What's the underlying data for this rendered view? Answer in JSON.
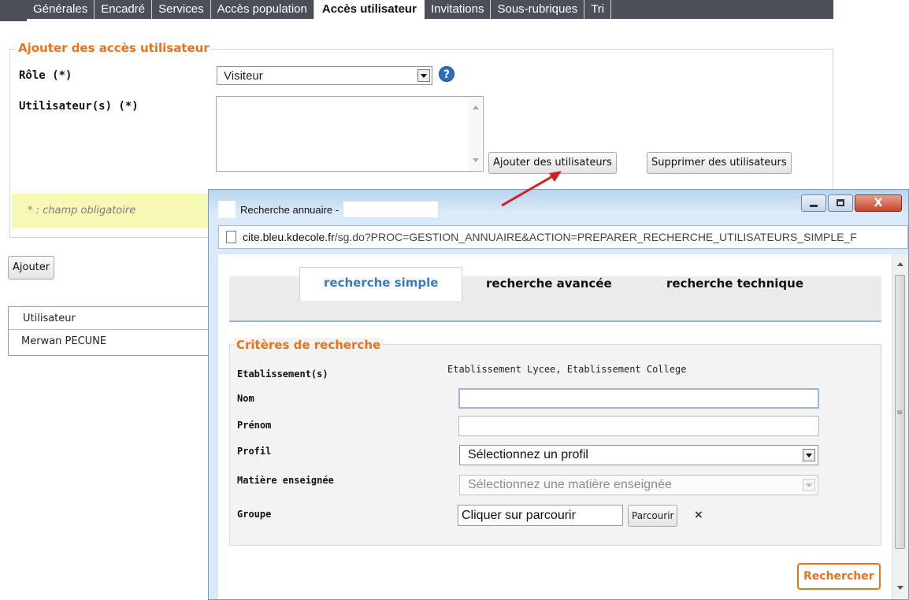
{
  "tabs": [
    {
      "label": "Générales",
      "active": false
    },
    {
      "label": "Encadré",
      "active": false
    },
    {
      "label": "Services",
      "active": false
    },
    {
      "label": "Accès population",
      "active": false
    },
    {
      "label": "Accès utilisateur",
      "active": true
    },
    {
      "label": "Invitations",
      "active": false
    },
    {
      "label": "Sous-rubriques",
      "active": false
    },
    {
      "label": "Tri",
      "active": false
    }
  ],
  "form": {
    "legend": "Ajouter des accès utilisateur",
    "role_label": "Rôle (*)",
    "role_value": "Visiteur",
    "help_icon": "question-icon",
    "users_label": "Utilisateur(s) (*)",
    "add_users_button": "Ajouter des utilisateurs",
    "remove_users_button": "Supprimer des utilisateurs",
    "required_note": "* : champ obligatoire",
    "submit_button": "Ajouter"
  },
  "table": {
    "header": "Utilisateur",
    "rows": [
      "Merwan PECUNE"
    ]
  },
  "popup": {
    "title": "Recherche annuaire -",
    "url_host": "cite.bleu.kdecole.fr",
    "url_path": "/sg.do?PROC=GESTION_ANNUAIRE&ACTION=PREPARER_RECHERCHE_UTILISATEURS_SIMPLE_F",
    "search_tabs": [
      {
        "label": "recherche simple",
        "active": true
      },
      {
        "label": "recherche avancée",
        "active": false
      },
      {
        "label": "recherche technique",
        "active": false
      }
    ],
    "criteria": {
      "legend": "Critères de recherche",
      "etab_label": "Etablissement(s)",
      "etab_value": "Etablissement Lycee, Etablissement College",
      "nom_label": "Nom",
      "nom_value": "",
      "prenom_label": "Prénom",
      "prenom_value": "",
      "profil_label": "Profil",
      "profil_value": "Sélectionnez un profil",
      "matiere_label": "Matière enseignée",
      "matiere_value": "Sélectionnez une matière enseignée",
      "groupe_label": "Groupe",
      "groupe_value": "Cliquer sur parcourir",
      "browse_button": "Parcourir",
      "clear_icon": "×"
    },
    "search_button": "Rechercher"
  },
  "colors": {
    "accent": "#e8731c",
    "tab_bg": "#4a4f58",
    "link_blue": "#3a7abf",
    "note_bg": "#f6f9b4"
  }
}
